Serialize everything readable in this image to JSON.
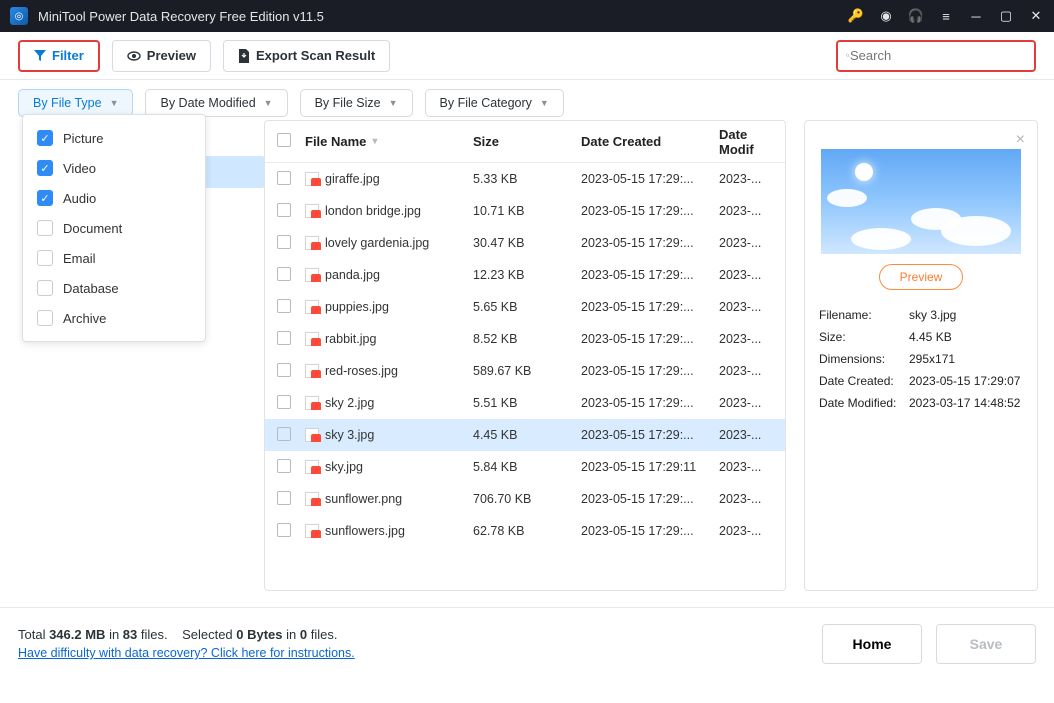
{
  "titlebar": {
    "title": "MiniTool Power Data Recovery Free Edition v11.5"
  },
  "toolbar": {
    "filter_label": "Filter",
    "preview_label": "Preview",
    "export_label": "Export Scan Result",
    "search_placeholder": "Search"
  },
  "filters": {
    "chips": [
      "By File Type",
      "By Date Modified",
      "By File Size",
      "By File Category"
    ],
    "dropdown": [
      {
        "label": "Picture",
        "checked": true
      },
      {
        "label": "Video",
        "checked": true
      },
      {
        "label": "Audio",
        "checked": true
      },
      {
        "label": "Document",
        "checked": false
      },
      {
        "label": "Email",
        "checked": false
      },
      {
        "label": "Database",
        "checked": false
      },
      {
        "label": "Archive",
        "checked": false
      }
    ]
  },
  "table": {
    "headers": {
      "name": "File Name",
      "size": "Size",
      "created": "Date Created",
      "modified": "Date Modif"
    },
    "selected_index": 8,
    "rows": [
      {
        "name": "giraffe.jpg",
        "size": "5.33 KB",
        "created": "2023-05-15 17:29:...",
        "modified": "2023-..."
      },
      {
        "name": "london bridge.jpg",
        "size": "10.71 KB",
        "created": "2023-05-15 17:29:...",
        "modified": "2023-..."
      },
      {
        "name": "lovely gardenia.jpg",
        "size": "30.47 KB",
        "created": "2023-05-15 17:29:...",
        "modified": "2023-..."
      },
      {
        "name": "panda.jpg",
        "size": "12.23 KB",
        "created": "2023-05-15 17:29:...",
        "modified": "2023-..."
      },
      {
        "name": "puppies.jpg",
        "size": "5.65 KB",
        "created": "2023-05-15 17:29:...",
        "modified": "2023-..."
      },
      {
        "name": "rabbit.jpg",
        "size": "8.52 KB",
        "created": "2023-05-15 17:29:...",
        "modified": "2023-..."
      },
      {
        "name": "red-roses.jpg",
        "size": "589.67 KB",
        "created": "2023-05-15 17:29:...",
        "modified": "2023-..."
      },
      {
        "name": "sky 2.jpg",
        "size": "5.51 KB",
        "created": "2023-05-15 17:29:...",
        "modified": "2023-..."
      },
      {
        "name": "sky 3.jpg",
        "size": "4.45 KB",
        "created": "2023-05-15 17:29:...",
        "modified": "2023-..."
      },
      {
        "name": "sky.jpg",
        "size": "5.84 KB",
        "created": "2023-05-15 17:29:11",
        "modified": "2023-..."
      },
      {
        "name": "sunflower.png",
        "size": "706.70 KB",
        "created": "2023-05-15 17:29:...",
        "modified": "2023-..."
      },
      {
        "name": "sunflowers.jpg",
        "size": "62.78 KB",
        "created": "2023-05-15 17:29:...",
        "modified": "2023-..."
      }
    ]
  },
  "preview": {
    "button": "Preview",
    "meta_labels": {
      "filename": "Filename:",
      "size": "Size:",
      "dimensions": "Dimensions:",
      "created": "Date Created:",
      "modified": "Date Modified:"
    },
    "meta": {
      "filename": "sky 3.jpg",
      "size": "4.45 KB",
      "dimensions": "295x171",
      "created": "2023-05-15 17:29:07",
      "modified": "2023-03-17 14:48:52"
    }
  },
  "footer": {
    "total_prefix": "Total ",
    "total_size": "346.2 MB",
    "total_mid": " in ",
    "total_count": "83",
    "total_suffix": " files.",
    "selected_prefix": "Selected ",
    "selected_bytes": "0 Bytes",
    "selected_mid": " in ",
    "selected_count": "0",
    "selected_suffix": " files.",
    "help_link": "Have difficulty with data recovery? Click here for instructions.",
    "home": "Home",
    "save": "Save"
  }
}
